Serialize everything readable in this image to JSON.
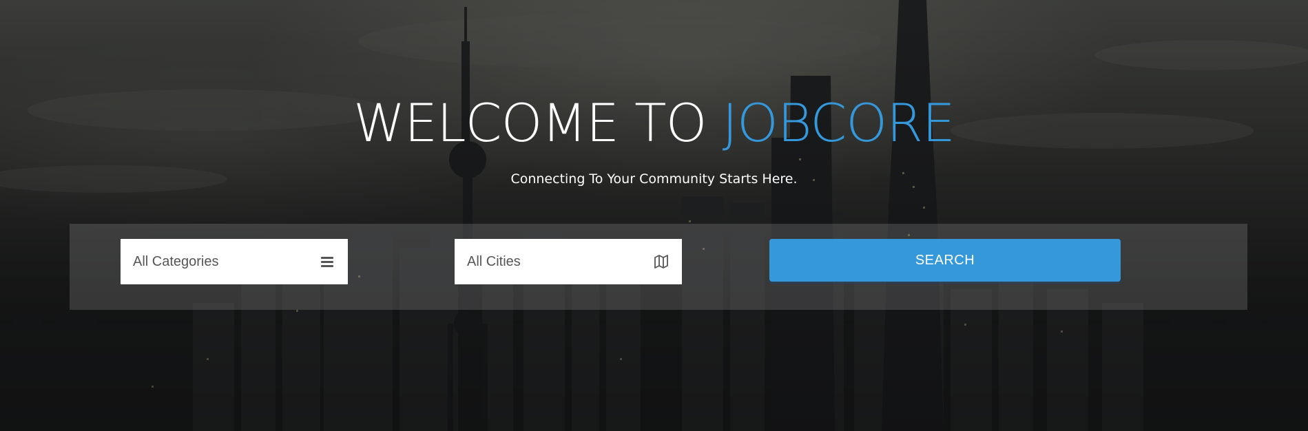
{
  "hero": {
    "title_main": "WELCOME TO ",
    "title_accent": "JOBCORE",
    "subtitle": "Connecting To Your Community Starts Here."
  },
  "search": {
    "category_select": {
      "selected": "All Categories",
      "icon": "list-icon"
    },
    "city_select": {
      "selected": "All Cities",
      "icon": "map-icon"
    },
    "button_label": "SEARCH"
  },
  "colors": {
    "accent": "#3498db",
    "title": "#ffffff",
    "panel_overlay": "rgba(255,255,255,0.15)"
  }
}
